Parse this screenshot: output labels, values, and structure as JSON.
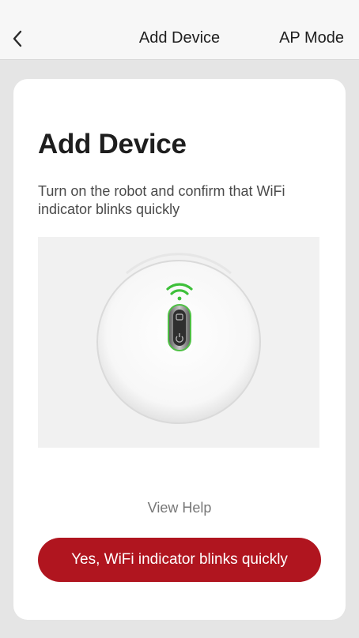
{
  "nav": {
    "back_icon": "chevron-left-icon",
    "title": "Add Device",
    "right_action": "AP Mode"
  },
  "card": {
    "heading": "Add Device",
    "description": "Turn on the robot and confirm that WiFi indicator blinks quickly",
    "illustration": {
      "subject": "robot-top-view",
      "wifi_indicator_color": "#3ec03a"
    },
    "help_link": "View Help",
    "confirm_button": "Yes, WiFi indicator blinks quickly"
  },
  "colors": {
    "accent": "#b0151f",
    "background": "#e5e5e5",
    "card": "#ffffff"
  }
}
